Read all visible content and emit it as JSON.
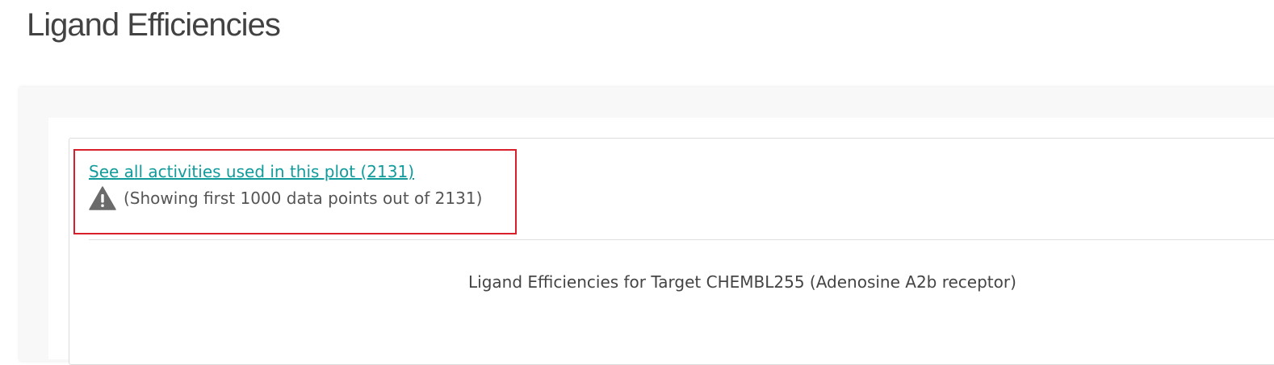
{
  "page": {
    "title": "Ligand Efficiencies"
  },
  "activities": {
    "link_label": "See all activities used in this plot (2131)",
    "warning_icon": "warning-triangle-icon",
    "warning_text": "(Showing first 1000 data points out of 2131)"
  },
  "plot": {
    "title": "Ligand Efficiencies for Target CHEMBL255 (Adenosine A2b receptor)"
  },
  "colors": {
    "link": "#129b9b",
    "highlight_border": "#d91f2b",
    "warning_icon": "#6b6b6b"
  }
}
